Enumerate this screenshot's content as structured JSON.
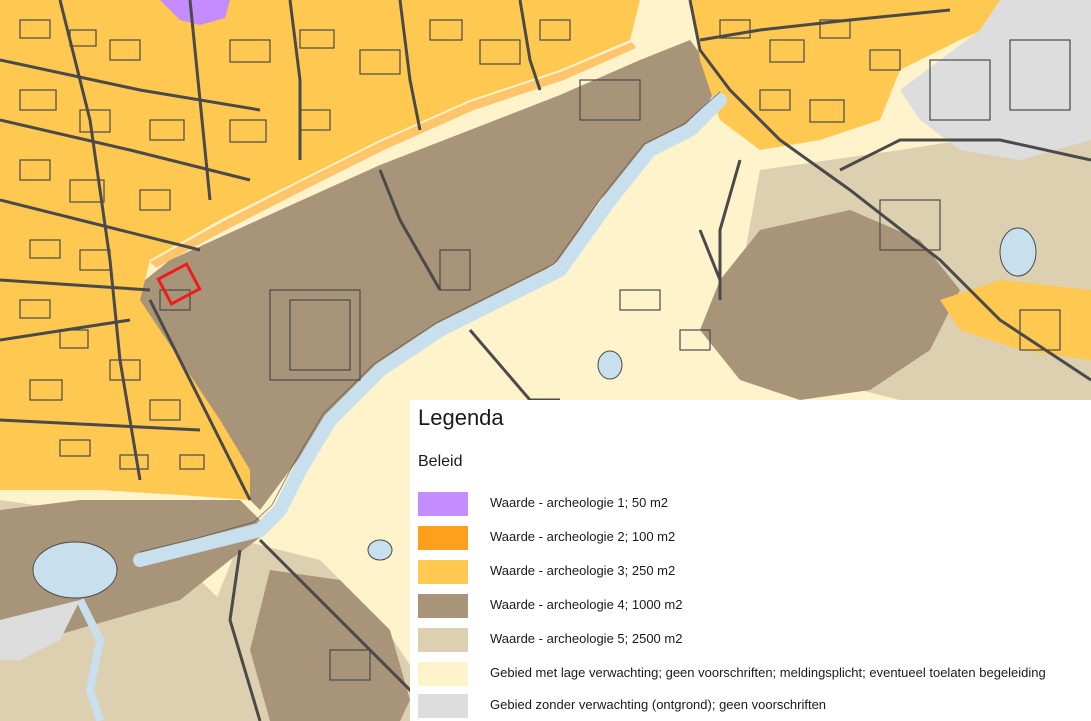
{
  "legend": {
    "title": "Legenda",
    "subtitle": "Beleid",
    "items": [
      {
        "label": "Waarde - archeologie 1; 50 m2",
        "color": "#c58cff"
      },
      {
        "label": "Waarde - archeologie 2; 100 m2",
        "color": "#ff9f1c"
      },
      {
        "label": "Waarde - archeologie 3; 250 m2",
        "color": "#ffc850"
      },
      {
        "label": "Waarde - archeologie 4; 1000 m2",
        "color": "#a89478"
      },
      {
        "label": "Waarde - archeologie 5; 2500 m2",
        "color": "#ddd0b0"
      },
      {
        "label": "Gebied met lage verwachting; geen voorschriften; meldingsplicht; eventueel toelaten begeleiding",
        "color": "#fff3cc"
      },
      {
        "label": "Gebied zonder verwachting (ontgrond); geen voorschriften",
        "color": "#dddddd"
      }
    ]
  },
  "map_colors": {
    "water": "#c8dfee",
    "outline": "#4a4a4a",
    "highlight": "#ee1c1c"
  }
}
